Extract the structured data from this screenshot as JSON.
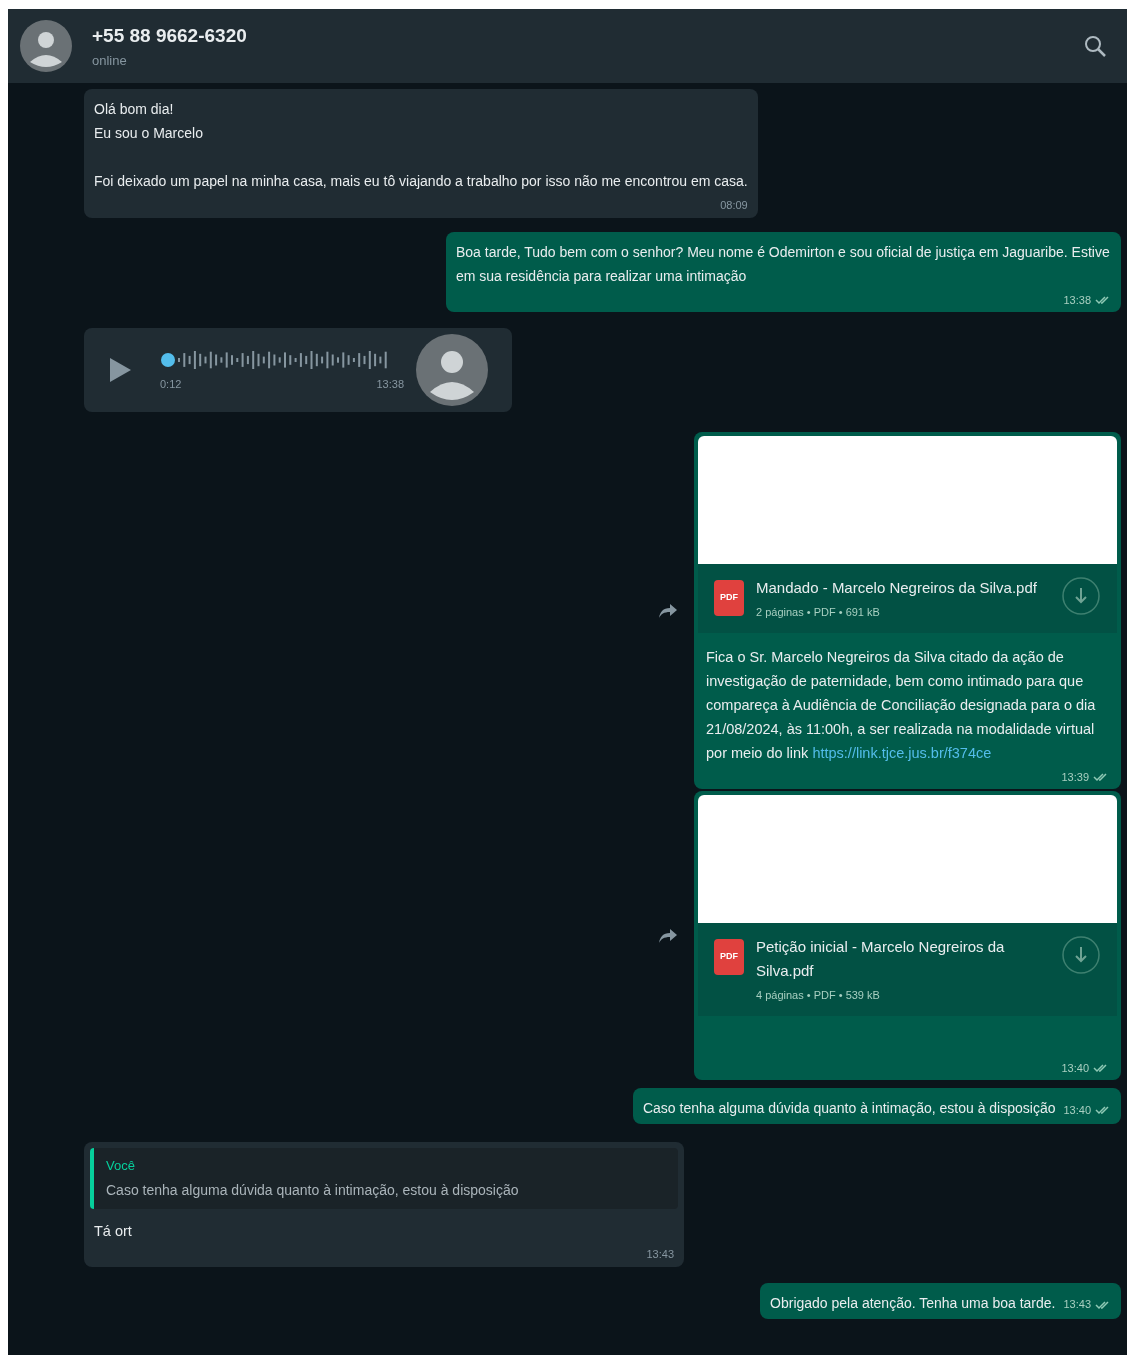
{
  "header": {
    "title": "+55 88 9662-6320",
    "subtitle": "online"
  },
  "messages": [
    {
      "kind": "text",
      "outgoing": false,
      "paragraphs": [
        [
          "Olá bom dia!",
          "Eu sou o Marcelo"
        ],
        [
          "Foi deixado um papel na minha casa, mais eu tô viajando a trabalho por isso não me encontrou em casa."
        ]
      ],
      "time": "08:09"
    },
    {
      "kind": "text",
      "outgoing": true,
      "paragraphs": [
        [
          "Boa tarde, Tudo bem com o senhor? Meu nome é Odemirton e sou oficial de justiça em Jaguaribe. Estive em sua residência para realizar uma intimação"
        ]
      ],
      "time": "13:38"
    },
    {
      "kind": "voice",
      "outgoing": false,
      "duration": "0:12",
      "time": "13:38"
    },
    {
      "kind": "document",
      "outgoing": true,
      "forward": true,
      "file_name": "Mandado - Marcelo Negreiros da Silva.pdf",
      "file_meta": "2 páginas • PDF • 691 kB",
      "file_type": "PDF",
      "caption": "Fica o Sr. Marcelo Negreiros da Silva citado da ação de investigação de paternidade, bem como intimado para que compareça à Audiência de Conciliação designada para o dia 21/08/2024, às 11:00h, a ser realizada na modalidade virtual por meio do link",
      "link": "https://link.tjce.jus.br/f374ce",
      "time": "13:39"
    },
    {
      "kind": "document",
      "outgoing": true,
      "forward": true,
      "file_name": "Petição inicial - Marcelo Negreiros da Silva.pdf",
      "file_meta": "4 páginas • PDF • 539 kB",
      "file_type": "PDF",
      "time": "13:40"
    },
    {
      "kind": "text",
      "outgoing": true,
      "paragraphs": [
        [
          "Caso tenha alguma dúvida quanto à intimação, estou à disposição"
        ]
      ],
      "time": "13:40"
    },
    {
      "kind": "reply",
      "outgoing": false,
      "quoted_author": "Você",
      "quoted_text": "Caso tenha alguma dúvida quanto à intimação, estou à disposição",
      "lines": [
        "Tá ort"
      ],
      "time": "13:43"
    },
    {
      "kind": "text",
      "outgoing": true,
      "paragraphs": [
        [
          "Obrigado pela atenção. Tenha uma boa tarde."
        ]
      ],
      "time": "13:43"
    }
  ]
}
